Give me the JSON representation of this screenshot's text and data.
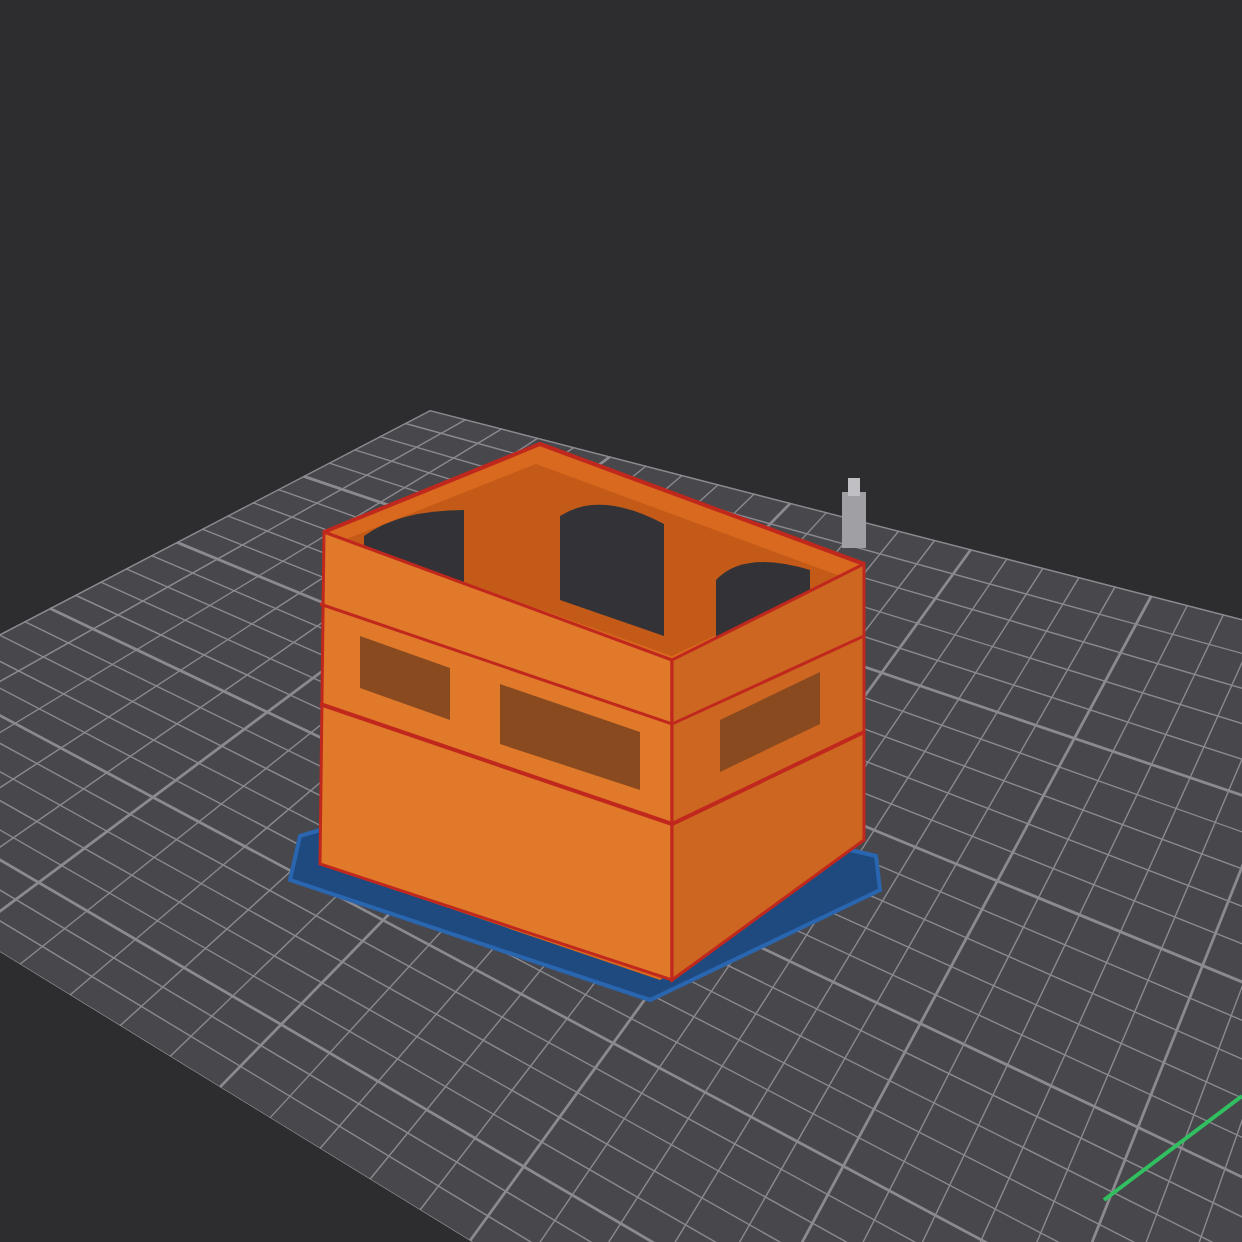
{
  "viewport": {
    "objects": [
      {
        "kind": "skirt"
      },
      {
        "kind": "crate"
      },
      {
        "kind": "wipe_tower"
      }
    ]
  }
}
